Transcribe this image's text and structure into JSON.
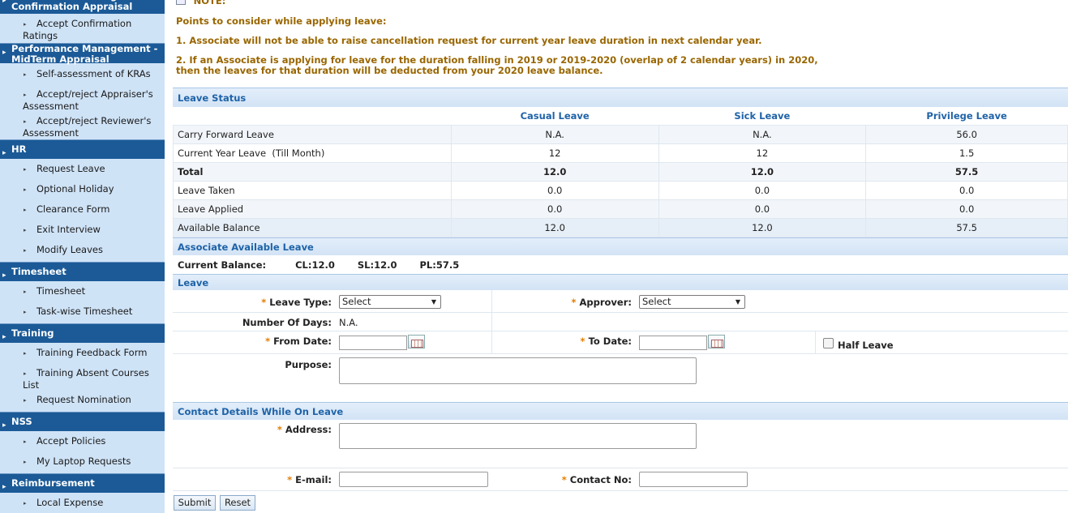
{
  "sidebar": {
    "sections": [
      {
        "title": "Performance Management - Confirmation Appraisal",
        "items": [
          "Accept Confirmation Ratings"
        ]
      },
      {
        "title": "Performance Management - MidTerm Appraisal",
        "items": [
          "Self-assessment of KRAs",
          "Accept/reject Appraiser's Assessment",
          "Accept/reject Reviewer's Assessment"
        ]
      },
      {
        "title": "HR",
        "items": [
          "Request Leave",
          "Optional Holiday",
          "Clearance Form",
          "Exit Interview",
          "Modify Leaves"
        ]
      },
      {
        "title": "Timesheet",
        "items": [
          "Timesheet",
          "Task-wise Timesheet"
        ]
      },
      {
        "title": "Training",
        "items": [
          "Training Feedback Form",
          "Training Absent Courses List",
          "Request Nomination"
        ]
      },
      {
        "title": "NSS",
        "items": [
          "Accept Policies",
          "My Laptop Requests"
        ]
      },
      {
        "title": "Reimbursement",
        "items": [
          "Local Expense"
        ]
      }
    ]
  },
  "note": {
    "label": "NOTE:",
    "heading": "Points to consider while applying leave:",
    "point1": "1. Associate will not be able to raise cancellation request for current year leave duration in next calendar year.",
    "point2_line1": "2. If an Associate is applying for leave for the duration falling in 2019 or 2019-2020 (overlap of 2 calendar years) in 2020,",
    "point2_line2": "then the leaves for that duration will be deducted from your 2020 leave balance."
  },
  "leave_status": {
    "title": "Leave Status",
    "columns": [
      "Casual Leave",
      "Sick Leave",
      "Privilege Leave"
    ],
    "rows": [
      {
        "label": "Carry Forward Leave",
        "values": [
          "N.A.",
          "N.A.",
          "56.0"
        ]
      },
      {
        "label": "Current Year Leave  (Till Month)",
        "values": [
          "12",
          "12",
          "1.5"
        ]
      },
      {
        "label": "Total",
        "values": [
          "12.0",
          "12.0",
          "57.5"
        ]
      },
      {
        "label": "Leave Taken",
        "values": [
          "0.0",
          "0.0",
          "0.0"
        ]
      },
      {
        "label": "Leave Applied",
        "values": [
          "0.0",
          "0.0",
          "0.0"
        ]
      },
      {
        "label": "Available Balance",
        "values": [
          "12.0",
          "12.0",
          "57.5"
        ]
      }
    ]
  },
  "available": {
    "title": "Associate Available Leave",
    "label": "Current Balance:",
    "cl": "CL:12.0",
    "sl": "SL:12.0",
    "pl": "PL:57.5"
  },
  "leave_form": {
    "title": "Leave",
    "required_mark": "*",
    "leave_type_label": "Leave Type:",
    "leave_type_value": "Select",
    "approver_label": "Approver:",
    "approver_value": "Select",
    "days_label": "Number Of Days:",
    "days_value": "N.A.",
    "from_label": "From Date:",
    "to_label": "To Date:",
    "half_leave_label": "Half Leave",
    "purpose_label": "Purpose:"
  },
  "contact": {
    "title": "Contact Details While On Leave",
    "address_label": "Address:",
    "email_label": "E-mail:",
    "contact_label": "Contact No:"
  },
  "buttons": {
    "submit": "Submit",
    "reset": "Reset"
  }
}
